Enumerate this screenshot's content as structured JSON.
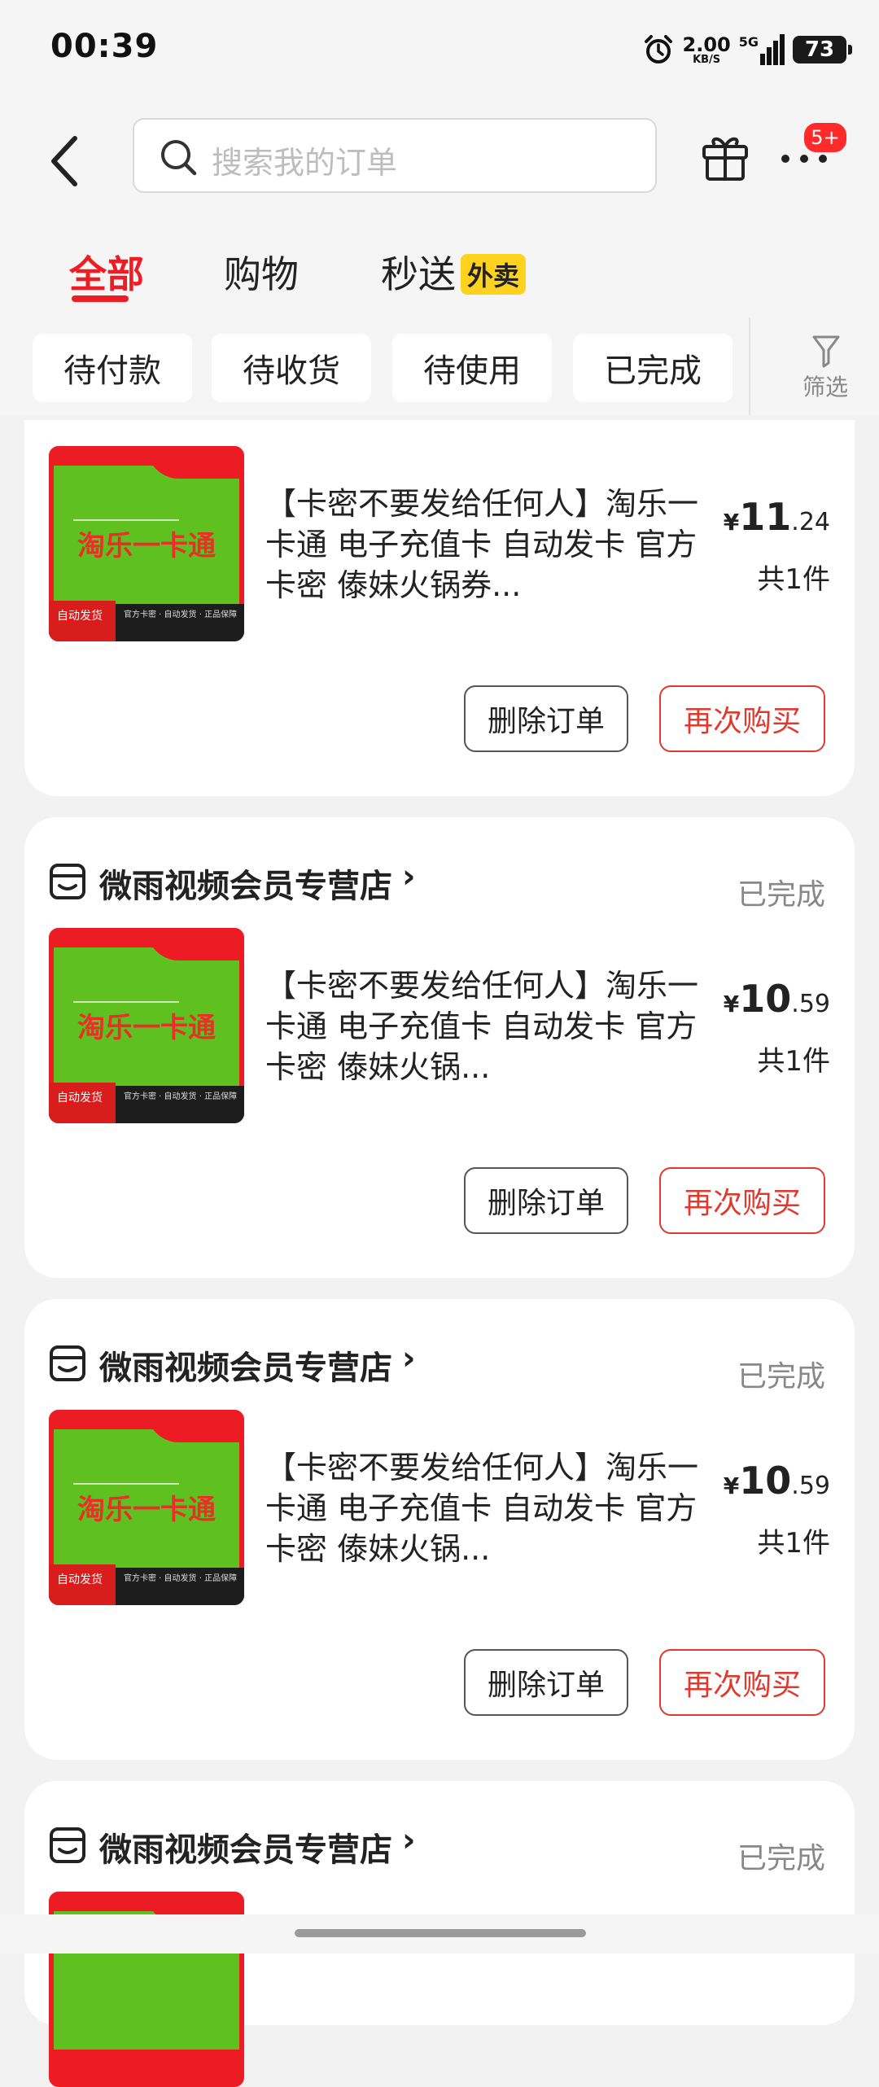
{
  "status_bar": {
    "time": "00:39",
    "net_speed": "2.00",
    "net_unit": "KB/S",
    "network": "5G",
    "battery": "73"
  },
  "header": {
    "search_placeholder": "搜索我的订单",
    "badge": "5+"
  },
  "tabs": [
    {
      "label": "全部",
      "active": true
    },
    {
      "label": "购物",
      "active": false
    },
    {
      "label": "秒送",
      "active": false,
      "tag": "外卖"
    }
  ],
  "filters": [
    "待付款",
    "待收货",
    "待使用",
    "已完成"
  ],
  "filter_button_label": "筛选",
  "actions": {
    "delete_label": "删除订单",
    "rebuy_label": "再次购买"
  },
  "orders": [
    {
      "shop_name": "",
      "status": "",
      "product_title": "【卡密不要发给任何人】淘乐一卡通 电子充值卡 自动发卡 官方卡密 傣妹火锅券...",
      "thumb_title": "淘乐一卡通",
      "thumb_badge": "自动发货",
      "thumb_features": "官方卡密 · 自动发货 · 正品保障",
      "price_symbol": "¥",
      "price_int": "11",
      "price_dec": ".24",
      "quantity": "共1件"
    },
    {
      "shop_name": "微雨视频会员专营店",
      "status": "已完成",
      "product_title": "【卡密不要发给任何人】淘乐一卡通 电子充值卡 自动发卡 官方卡密 傣妹火锅...",
      "thumb_title": "淘乐一卡通",
      "thumb_badge": "自动发货",
      "thumb_features": "官方卡密 · 自动发货 · 正品保障",
      "price_symbol": "¥",
      "price_int": "10",
      "price_dec": ".59",
      "quantity": "共1件"
    },
    {
      "shop_name": "微雨视频会员专营店",
      "status": "已完成",
      "product_title": "【卡密不要发给任何人】淘乐一卡通 电子充值卡 自动发卡 官方卡密 傣妹火锅...",
      "thumb_title": "淘乐一卡通",
      "thumb_badge": "自动发货",
      "thumb_features": "官方卡密 · 自动发货 · 正品保障",
      "price_symbol": "¥",
      "price_int": "10",
      "price_dec": ".59",
      "quantity": "共1件"
    },
    {
      "shop_name": "微雨视频会员专营店",
      "status": "已完成"
    }
  ],
  "colors": {
    "accent": "#ee1d24",
    "rebuy": "#e03a2f",
    "tag_yellow": "#ffd21f"
  }
}
